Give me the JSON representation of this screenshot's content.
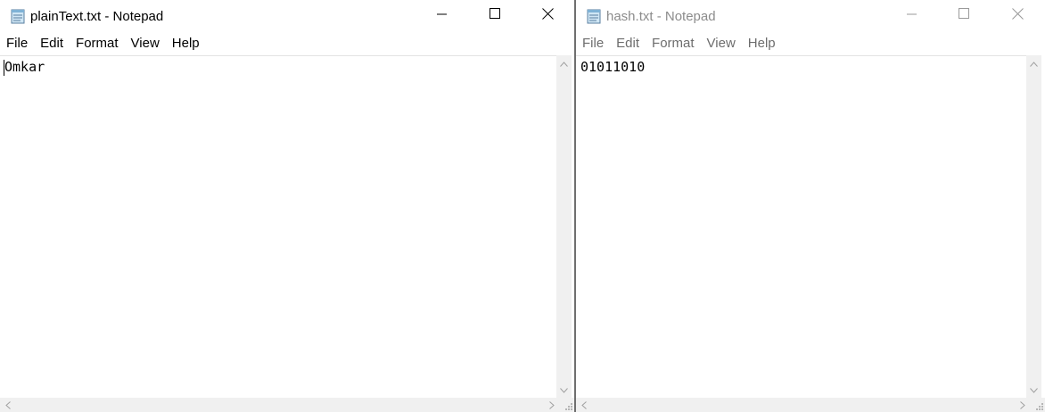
{
  "left_window": {
    "title": "plainText.txt - Notepad",
    "menu": [
      "File",
      "Edit",
      "Format",
      "View",
      "Help"
    ],
    "content": "Omkar",
    "icons": {
      "app": "notepad-icon",
      "minimize": "minimize-icon",
      "maximize": "maximize-icon",
      "close": "close-icon"
    }
  },
  "right_window": {
    "title": "hash.txt - Notepad",
    "menu": [
      "File",
      "Edit",
      "Format",
      "View",
      "Help"
    ],
    "content": "01011010",
    "icons": {
      "app": "notepad-icon",
      "minimize": "minimize-icon",
      "maximize": "maximize-icon",
      "close": "close-icon"
    }
  },
  "colors": {
    "active_text": "#000000",
    "inactive_text": "#8c8c8c",
    "scrollbar": "#f0f0f0",
    "divider": "#6f6f6f"
  }
}
